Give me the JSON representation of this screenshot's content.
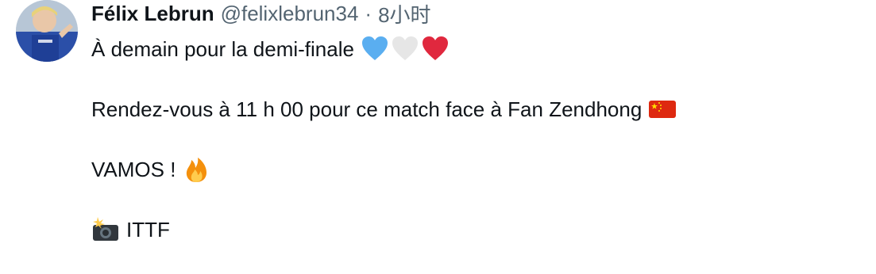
{
  "tweet": {
    "author_name": "Félix Lebrun",
    "handle": "@felixlebrun34",
    "separator": "·",
    "time": "8小时",
    "line1": "À demain pour la demi-finale",
    "line1_emojis": [
      "blue-heart-icon",
      "white-heart-icon",
      "red-heart-icon"
    ],
    "line2": "Rendez-vous à 11 h 00 pour ce match face à Fan Zendhong",
    "line2_emoji": "china-flag-icon",
    "line3": "VAMOS !",
    "line3_emoji": "fire-icon",
    "line4": "ITTF",
    "line4_emoji": "camera-flash-icon"
  },
  "colors": {
    "text": "#0f1419",
    "muted": "#536471",
    "blue_heart": "#5aaef0",
    "white_heart": "#e6e6e6",
    "red_heart": "#e0283e",
    "flag_red": "#de2910",
    "flag_yellow": "#ffde00"
  }
}
